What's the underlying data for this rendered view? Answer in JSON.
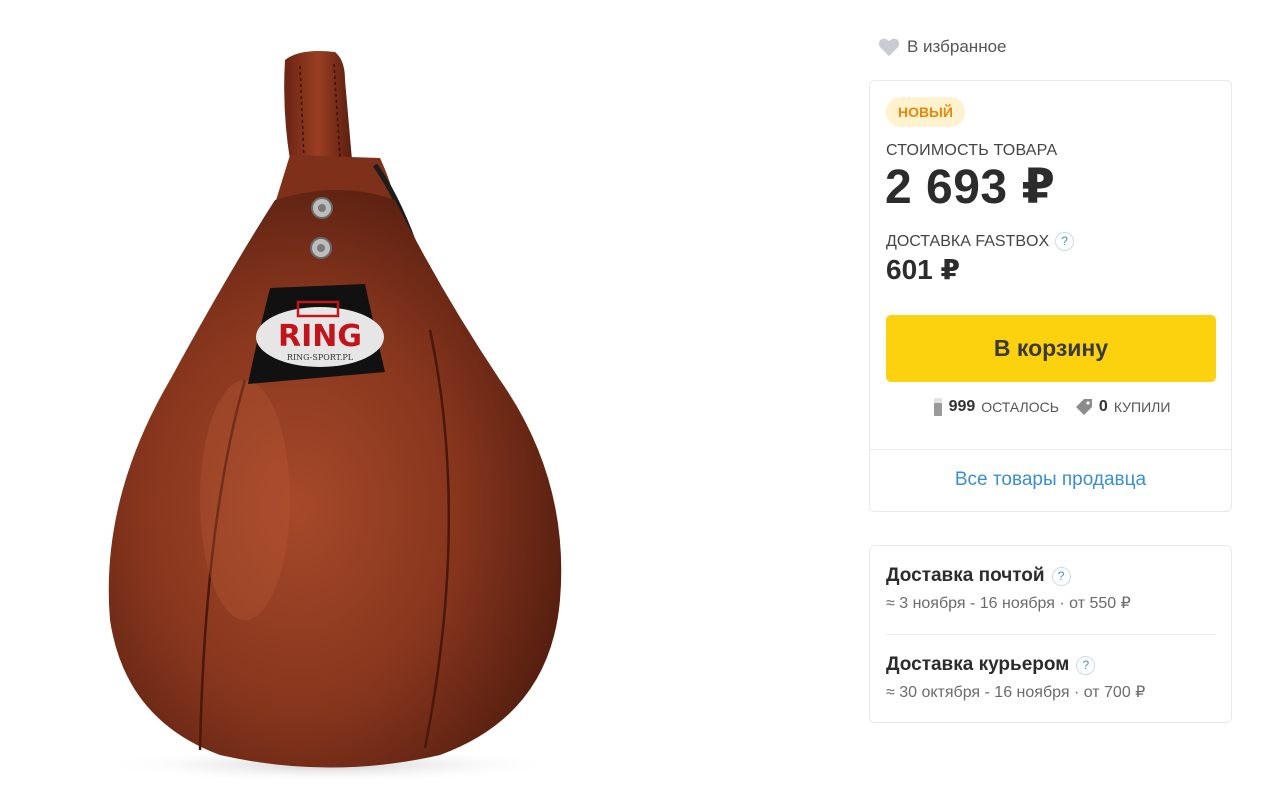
{
  "favorites": {
    "label": "В избранное",
    "icon": "heart-icon"
  },
  "offer": {
    "badge": "НОВЫЙ",
    "price_label": "СТОИМОСТЬ ТОВАРА",
    "price_value": "2 693 ₽",
    "delivery_label": "ДОСТАВКА FASTBOX",
    "delivery_help": "?",
    "delivery_price": "601 ₽",
    "cart_button": "В корзину",
    "stock_count": "999",
    "stock_label": "ОСТАЛОСЬ",
    "bought_count": "0",
    "bought_label": "КУПИЛИ",
    "seller_link": "Все товары продавца"
  },
  "shipping": [
    {
      "title": "Доставка почтой",
      "help": "?",
      "details": "≈ 3 ноября - 16 ноября · от 550 ₽"
    },
    {
      "title": "Доставка курьером",
      "help": "?",
      "details": "≈ 30 октября - 16 ноября · от 700 ₽"
    }
  ],
  "product_image": {
    "alt_icon": "punching-bag-image",
    "logo_text": "RING",
    "logo_subtext": "RING-SPORT.PL"
  },
  "colors": {
    "accent_yellow": "#fcd20f",
    "badge_bg": "#fff3cf",
    "badge_text": "#e6870a",
    "link_blue": "#3a8fd0",
    "leather": "#8b3a22"
  }
}
